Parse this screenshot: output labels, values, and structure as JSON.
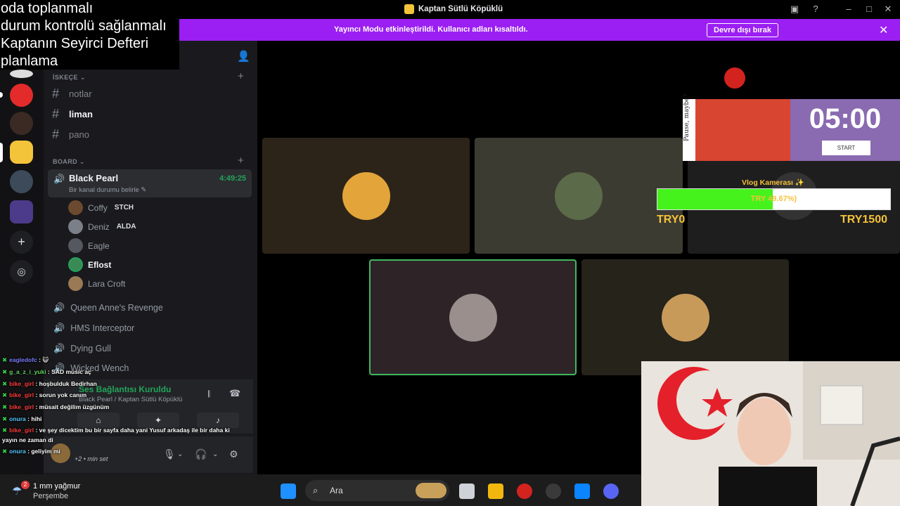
{
  "window": {
    "title": "Kaptan Sütlü Köpüklü"
  },
  "banner": {
    "message": "Yayıncı Modu etkinleştirildi. Kullanıcı adları kısaltıldı.",
    "button": "Devre dışı bırak"
  },
  "notes": [
    "oda toplanmalı",
    "durum kontrolü sağlanmalı",
    "Kaptanın Seyirci Defteri",
    "planlama"
  ],
  "categories": {
    "first": "İSKEÇE",
    "second": "BOARD"
  },
  "text_channels": [
    "notlar",
    "liman",
    "pano"
  ],
  "active_voice": {
    "name": "Black Pearl",
    "timer": "4:49:25",
    "status": "Bir kanal durumu belirle"
  },
  "members": [
    {
      "name": "Coffy",
      "tag": "STCH"
    },
    {
      "name": "Deniz",
      "tag": "ALDA"
    },
    {
      "name": "Eagle",
      "tag": ""
    },
    {
      "name": "Eflost",
      "tag": ""
    },
    {
      "name": "Lara Croft",
      "tag": ""
    }
  ],
  "voice_channels": [
    "Queen Anne's Revenge",
    "HMS Interceptor",
    "Dying Gull",
    "Wicked Wench"
  ],
  "voice_connection": {
    "status": "Ses Bağlantısı Kuruldu",
    "location": "Black Pearl / Kaptan Sütlü Köpüklü"
  },
  "user_panel": {
    "status_text": "+2 • min set"
  },
  "chat": [
    {
      "user": "eagledofc",
      "text": ""
    },
    {
      "user": "g_a_z_i_yuki",
      "text": "SAD music aç"
    },
    {
      "user": "bike_girl",
      "text": "hoşbulduk Bedirhan"
    },
    {
      "user": "bike_girl",
      "text": "sorun yok canım"
    },
    {
      "user": "bike_girl",
      "text": "müsait değilim üzgünüm"
    },
    {
      "user": "onura",
      "text": "hihi"
    },
    {
      "user": "bike_girl",
      "text": "ve şey dicektim bu bir sayfa daha yani Yusuf arkadaş ile bir daha ki"
    },
    {
      "user": "",
      "text": "yayın ne zaman di"
    },
    {
      "user": "onura",
      "text": "geliyim mi"
    }
  ],
  "pomodoro": {
    "time": "05:00",
    "button": "START",
    "caption": "Pause, maybe?"
  },
  "goal": {
    "title": "Vlog Kamerası ✨",
    "progress_text": "TRY 49.67%)",
    "fraction": 0.4967,
    "min": "TRY0",
    "max": "TRY1500"
  },
  "weather": {
    "badge": "2",
    "line1": "1 mm yağmur",
    "line2": "Perşembe"
  },
  "taskbar": {
    "search": "Ara"
  },
  "colors": {
    "accent_purple": "#9b1ff2",
    "online_green": "#23a55a",
    "goal_yellow": "#f6c23a",
    "goal_green": "#45f21c"
  }
}
